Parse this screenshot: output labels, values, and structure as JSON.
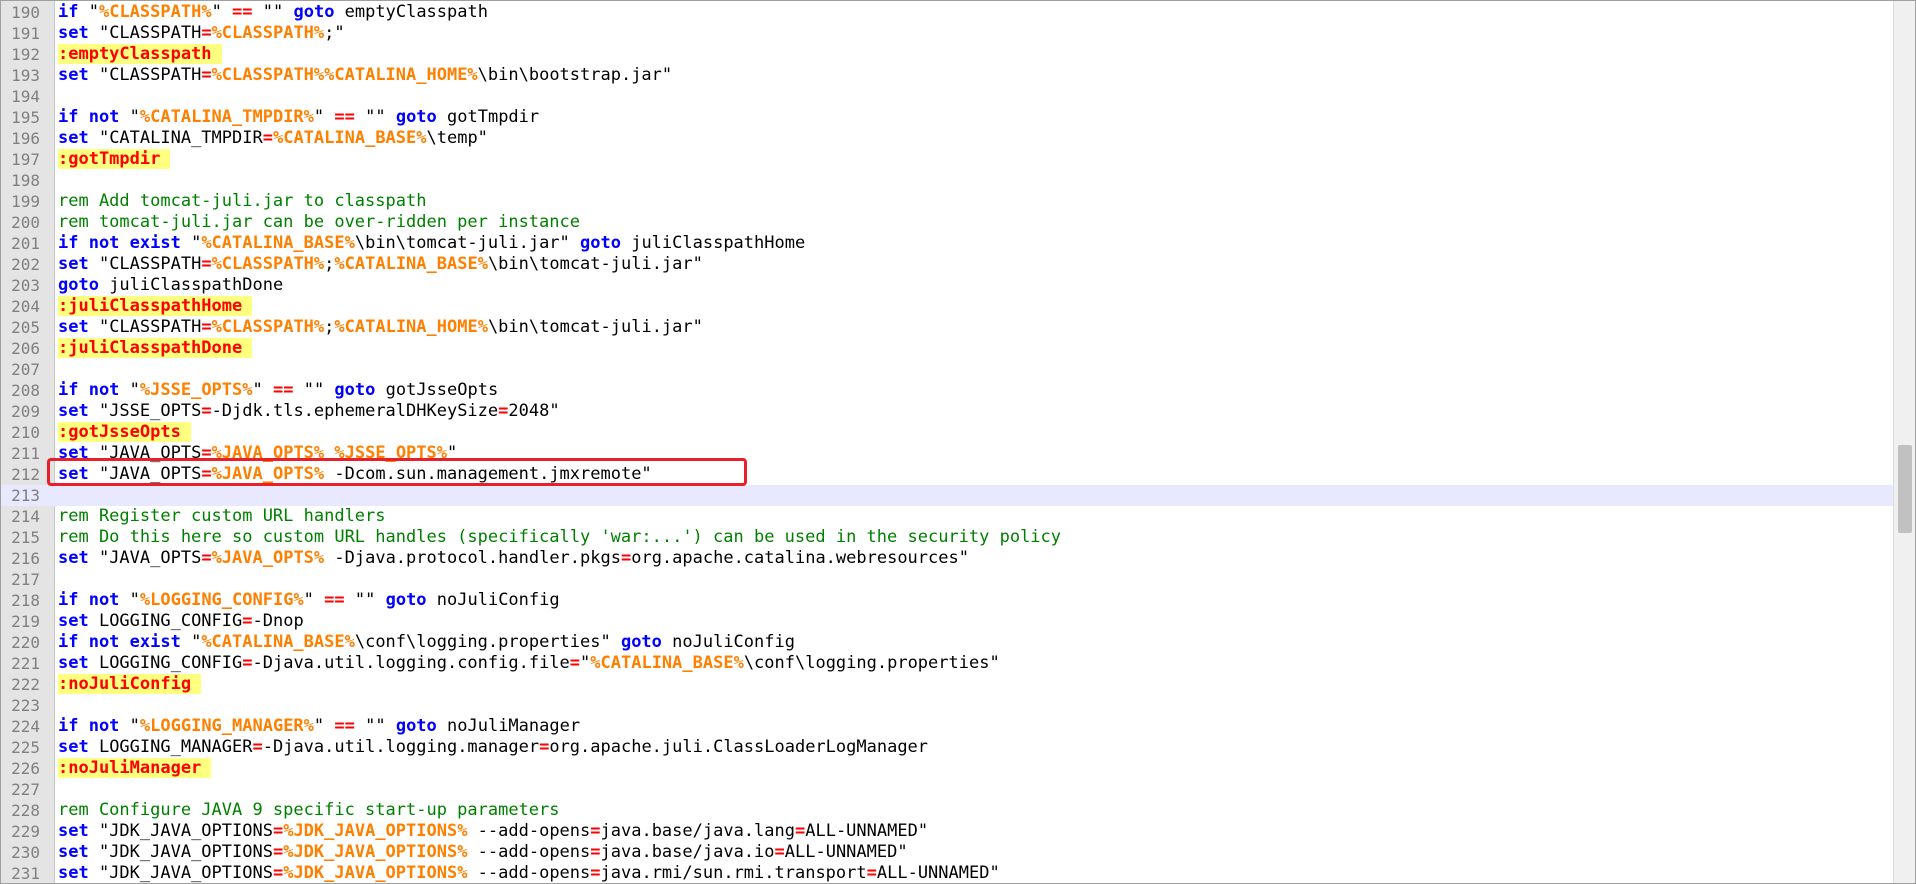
{
  "editor": {
    "current_line": 213,
    "highlighted_line": 212,
    "colors": {
      "keyword": "#0000ff",
      "variable": "#ff8000",
      "operator": "#ff0000",
      "comment": "#008000",
      "label_background": "#ffff80",
      "current_line_background": "#e8e8ff",
      "highlight_box": "#e8202a"
    },
    "lines": [
      {
        "num": "190",
        "tokens": [
          [
            "keyword",
            "if"
          ],
          [
            "text",
            " \""
          ],
          [
            "variable",
            "%CLASSPATH%"
          ],
          [
            "text",
            "\" "
          ],
          [
            "operator",
            "=="
          ],
          [
            "text",
            " \"\" "
          ],
          [
            "keyword",
            "goto"
          ],
          [
            "text",
            " emptyClasspath"
          ]
        ]
      },
      {
        "num": "191",
        "tokens": [
          [
            "keyword",
            "set"
          ],
          [
            "text",
            " \"CLASSPATH"
          ],
          [
            "operator",
            "="
          ],
          [
            "variable",
            "%CLASSPATH%"
          ],
          [
            "text",
            ";\""
          ]
        ]
      },
      {
        "num": "192",
        "tokens": [
          [
            "label",
            ":emptyClasspath"
          ]
        ]
      },
      {
        "num": "193",
        "tokens": [
          [
            "keyword",
            "set"
          ],
          [
            "text",
            " \"CLASSPATH"
          ],
          [
            "operator",
            "="
          ],
          [
            "variable",
            "%CLASSPATH%%CATALINA_HOME%"
          ],
          [
            "text",
            "\\bin\\bootstrap.jar\""
          ]
        ]
      },
      {
        "num": "194",
        "tokens": []
      },
      {
        "num": "195",
        "tokens": [
          [
            "keyword",
            "if not"
          ],
          [
            "text",
            " \""
          ],
          [
            "variable",
            "%CATALINA_TMPDIR%"
          ],
          [
            "text",
            "\" "
          ],
          [
            "operator",
            "=="
          ],
          [
            "text",
            " \"\" "
          ],
          [
            "keyword",
            "goto"
          ],
          [
            "text",
            " gotTmpdir"
          ]
        ]
      },
      {
        "num": "196",
        "tokens": [
          [
            "keyword",
            "set"
          ],
          [
            "text",
            " \"CATALINA_TMPDIR"
          ],
          [
            "operator",
            "="
          ],
          [
            "variable",
            "%CATALINA_BASE%"
          ],
          [
            "text",
            "\\temp\""
          ]
        ]
      },
      {
        "num": "197",
        "tokens": [
          [
            "label",
            ":gotTmpdir"
          ]
        ]
      },
      {
        "num": "198",
        "tokens": []
      },
      {
        "num": "199",
        "tokens": [
          [
            "comment",
            "rem Add tomcat-juli.jar to classpath"
          ]
        ]
      },
      {
        "num": "200",
        "tokens": [
          [
            "comment",
            "rem tomcat-juli.jar can be over-ridden per instance"
          ]
        ]
      },
      {
        "num": "201",
        "tokens": [
          [
            "keyword",
            "if not exist"
          ],
          [
            "text",
            " \""
          ],
          [
            "variable",
            "%CATALINA_BASE%"
          ],
          [
            "text",
            "\\bin\\tomcat-juli.jar\" "
          ],
          [
            "keyword",
            "goto"
          ],
          [
            "text",
            " juliClasspathHome"
          ]
        ]
      },
      {
        "num": "202",
        "tokens": [
          [
            "keyword",
            "set"
          ],
          [
            "text",
            " \"CLASSPATH"
          ],
          [
            "operator",
            "="
          ],
          [
            "variable",
            "%CLASSPATH%"
          ],
          [
            "text",
            ";"
          ],
          [
            "variable",
            "%CATALINA_BASE%"
          ],
          [
            "text",
            "\\bin\\tomcat-juli.jar\""
          ]
        ]
      },
      {
        "num": "203",
        "tokens": [
          [
            "keyword",
            "goto"
          ],
          [
            "text",
            " juliClasspathDone"
          ]
        ]
      },
      {
        "num": "204",
        "tokens": [
          [
            "label",
            ":juliClasspathHome"
          ]
        ]
      },
      {
        "num": "205",
        "tokens": [
          [
            "keyword",
            "set"
          ],
          [
            "text",
            " \"CLASSPATH"
          ],
          [
            "operator",
            "="
          ],
          [
            "variable",
            "%CLASSPATH%"
          ],
          [
            "text",
            ";"
          ],
          [
            "variable",
            "%CATALINA_HOME%"
          ],
          [
            "text",
            "\\bin\\tomcat-juli.jar\""
          ]
        ]
      },
      {
        "num": "206",
        "tokens": [
          [
            "label",
            ":juliClasspathDone"
          ]
        ]
      },
      {
        "num": "207",
        "tokens": []
      },
      {
        "num": "208",
        "tokens": [
          [
            "keyword",
            "if not"
          ],
          [
            "text",
            " \""
          ],
          [
            "variable",
            "%JSSE_OPTS%"
          ],
          [
            "text",
            "\" "
          ],
          [
            "operator",
            "=="
          ],
          [
            "text",
            " \"\" "
          ],
          [
            "keyword",
            "goto"
          ],
          [
            "text",
            " gotJsseOpts"
          ]
        ]
      },
      {
        "num": "209",
        "tokens": [
          [
            "keyword",
            "set"
          ],
          [
            "text",
            " \"JSSE_OPTS"
          ],
          [
            "operator",
            "="
          ],
          [
            "text",
            "-Djdk.tls.ephemeralDHKeySize"
          ],
          [
            "operator",
            "="
          ],
          [
            "text",
            "2048\""
          ]
        ]
      },
      {
        "num": "210",
        "tokens": [
          [
            "label",
            ":gotJsseOpts"
          ]
        ]
      },
      {
        "num": "211",
        "tokens": [
          [
            "keyword",
            "set"
          ],
          [
            "text",
            " \"JAVA_OPTS"
          ],
          [
            "operator",
            "="
          ],
          [
            "variable",
            "%JAVA_OPTS%"
          ],
          [
            "text",
            " "
          ],
          [
            "variable",
            "%JSSE_OPTS%"
          ],
          [
            "text",
            "\""
          ]
        ]
      },
      {
        "num": "212",
        "tokens": [
          [
            "keyword",
            "set"
          ],
          [
            "text",
            " \"JAVA_OPTS"
          ],
          [
            "operator",
            "="
          ],
          [
            "variable",
            "%JAVA_OPTS%"
          ],
          [
            "text",
            " -Dcom.sun.management.jmxremote\""
          ]
        ]
      },
      {
        "num": "213",
        "tokens": []
      },
      {
        "num": "214",
        "tokens": [
          [
            "comment",
            "rem Register custom URL handlers"
          ]
        ]
      },
      {
        "num": "215",
        "tokens": [
          [
            "comment",
            "rem Do this here so custom URL handles (specifically 'war:...') can be used in the security policy"
          ]
        ]
      },
      {
        "num": "216",
        "tokens": [
          [
            "keyword",
            "set"
          ],
          [
            "text",
            " \"JAVA_OPTS"
          ],
          [
            "operator",
            "="
          ],
          [
            "variable",
            "%JAVA_OPTS%"
          ],
          [
            "text",
            " -Djava.protocol.handler.pkgs"
          ],
          [
            "operator",
            "="
          ],
          [
            "text",
            "org.apache.catalina.webresources\""
          ]
        ]
      },
      {
        "num": "217",
        "tokens": []
      },
      {
        "num": "218",
        "tokens": [
          [
            "keyword",
            "if not"
          ],
          [
            "text",
            " \""
          ],
          [
            "variable",
            "%LOGGING_CONFIG%"
          ],
          [
            "text",
            "\" "
          ],
          [
            "operator",
            "=="
          ],
          [
            "text",
            " \"\" "
          ],
          [
            "keyword",
            "goto"
          ],
          [
            "text",
            " noJuliConfig"
          ]
        ]
      },
      {
        "num": "219",
        "tokens": [
          [
            "keyword",
            "set"
          ],
          [
            "text",
            " LOGGING_CONFIG"
          ],
          [
            "operator",
            "="
          ],
          [
            "text",
            "-Dnop"
          ]
        ]
      },
      {
        "num": "220",
        "tokens": [
          [
            "keyword",
            "if not exist"
          ],
          [
            "text",
            " \""
          ],
          [
            "variable",
            "%CATALINA_BASE%"
          ],
          [
            "text",
            "\\conf\\logging.properties\" "
          ],
          [
            "keyword",
            "goto"
          ],
          [
            "text",
            " noJuliConfig"
          ]
        ]
      },
      {
        "num": "221",
        "tokens": [
          [
            "keyword",
            "set"
          ],
          [
            "text",
            " LOGGING_CONFIG"
          ],
          [
            "operator",
            "="
          ],
          [
            "text",
            "-Djava.util.logging.config.file"
          ],
          [
            "operator",
            "="
          ],
          [
            "text",
            "\""
          ],
          [
            "variable",
            "%CATALINA_BASE%"
          ],
          [
            "text",
            "\\conf\\logging.properties\""
          ]
        ]
      },
      {
        "num": "222",
        "tokens": [
          [
            "label",
            ":noJuliConfig"
          ]
        ]
      },
      {
        "num": "223",
        "tokens": []
      },
      {
        "num": "224",
        "tokens": [
          [
            "keyword",
            "if not"
          ],
          [
            "text",
            " \""
          ],
          [
            "variable",
            "%LOGGING_MANAGER%"
          ],
          [
            "text",
            "\" "
          ],
          [
            "operator",
            "=="
          ],
          [
            "text",
            " \"\" "
          ],
          [
            "keyword",
            "goto"
          ],
          [
            "text",
            " noJuliManager"
          ]
        ]
      },
      {
        "num": "225",
        "tokens": [
          [
            "keyword",
            "set"
          ],
          [
            "text",
            " LOGGING_MANAGER"
          ],
          [
            "operator",
            "="
          ],
          [
            "text",
            "-Djava.util.logging.manager"
          ],
          [
            "operator",
            "="
          ],
          [
            "text",
            "org.apache.juli.ClassLoaderLogManager"
          ]
        ]
      },
      {
        "num": "226",
        "tokens": [
          [
            "label",
            ":noJuliManager"
          ]
        ]
      },
      {
        "num": "227",
        "tokens": []
      },
      {
        "num": "228",
        "tokens": [
          [
            "comment",
            "rem Configure JAVA 9 specific start-up parameters"
          ]
        ]
      },
      {
        "num": "229",
        "tokens": [
          [
            "keyword",
            "set"
          ],
          [
            "text",
            " \"JDK_JAVA_OPTIONS"
          ],
          [
            "operator",
            "="
          ],
          [
            "variable",
            "%JDK_JAVA_OPTIONS%"
          ],
          [
            "text",
            " --add-opens"
          ],
          [
            "operator",
            "="
          ],
          [
            "text",
            "java.base/java.lang"
          ],
          [
            "operator",
            "="
          ],
          [
            "text",
            "ALL-UNNAMED\""
          ]
        ]
      },
      {
        "num": "230",
        "tokens": [
          [
            "keyword",
            "set"
          ],
          [
            "text",
            " \"JDK_JAVA_OPTIONS"
          ],
          [
            "operator",
            "="
          ],
          [
            "variable",
            "%JDK_JAVA_OPTIONS%"
          ],
          [
            "text",
            " --add-opens"
          ],
          [
            "operator",
            "="
          ],
          [
            "text",
            "java.base/java.io"
          ],
          [
            "operator",
            "="
          ],
          [
            "text",
            "ALL-UNNAMED\""
          ]
        ]
      },
      {
        "num": "231",
        "tokens": [
          [
            "keyword",
            "set"
          ],
          [
            "text",
            " \"JDK_JAVA_OPTIONS"
          ],
          [
            "operator",
            "="
          ],
          [
            "variable",
            "%JDK_JAVA_OPTIONS%"
          ],
          [
            "text",
            " --add-opens"
          ],
          [
            "operator",
            "="
          ],
          [
            "text",
            "java.rmi/sun.rmi.transport"
          ],
          [
            "operator",
            "="
          ],
          [
            "text",
            "ALL-UNNAMED\""
          ]
        ]
      }
    ]
  }
}
